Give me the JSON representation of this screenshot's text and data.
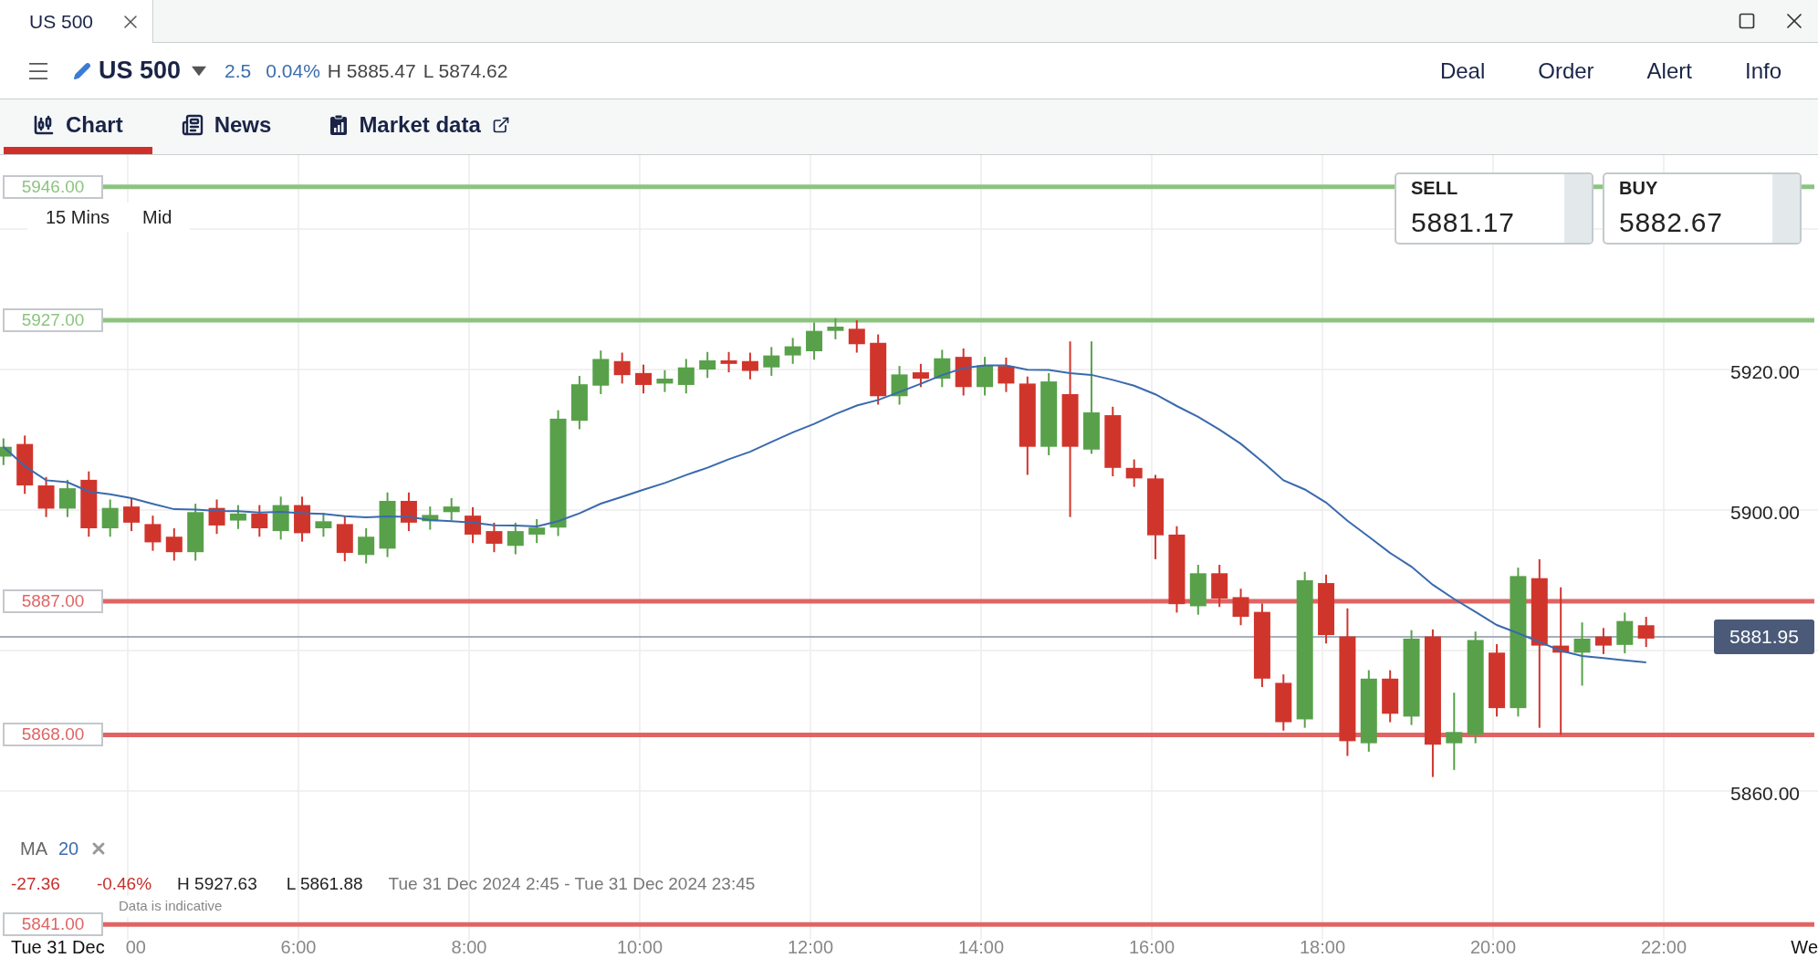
{
  "window_tab": {
    "title": "US 500",
    "selected": true
  },
  "header": {
    "instrument": "US 500",
    "change": "2.5",
    "change_pct": "0.04%",
    "high": "H 5885.47",
    "low": "L 5874.62",
    "actions": [
      "Deal",
      "Order",
      "Alert",
      "Info"
    ]
  },
  "tabs": [
    {
      "label": "Chart",
      "selected": true,
      "kind": "chart",
      "external": false
    },
    {
      "label": "News",
      "selected": false,
      "kind": "news",
      "external": false
    },
    {
      "label": "Market data",
      "selected": false,
      "kind": "market",
      "external": true
    }
  ],
  "chart": {
    "interval": "15 Mins",
    "price_type": "Mid",
    "sell": {
      "label": "SELL",
      "price": "5881.17"
    },
    "buy": {
      "label": "BUY",
      "price": "5882.67"
    },
    "levels": [
      {
        "label": "5946.00",
        "color": "#8cc47f"
      },
      {
        "label": "5927.00",
        "color": "#8cc47f"
      },
      {
        "label": "5887.00",
        "color": "#e06464"
      },
      {
        "label": "5868.00",
        "color": "#e06464"
      },
      {
        "label": "5841.00",
        "color": "#e06464"
      }
    ],
    "y_ticks": [
      "5920.00",
      "5900.00",
      "5860.00"
    ],
    "current_price": "5881.95",
    "x_ticks": [
      "00",
      "6:00",
      "8:00",
      "10:00",
      "12:00",
      "14:00",
      "16:00",
      "18:00",
      "20:00",
      "22:00"
    ],
    "date_label": "Tue 31 Dec",
    "next_date": "We",
    "indicator": {
      "name": "MA",
      "period": "20"
    },
    "stats": {
      "change": "-27.36",
      "change_pct": "-0.46%",
      "high": "H 5927.63",
      "low": "L 5861.88",
      "range": "Tue 31 Dec 2024 2:45 - Tue 31 Dec 2024 23:45"
    },
    "notice": "Data is indicative"
  }
}
